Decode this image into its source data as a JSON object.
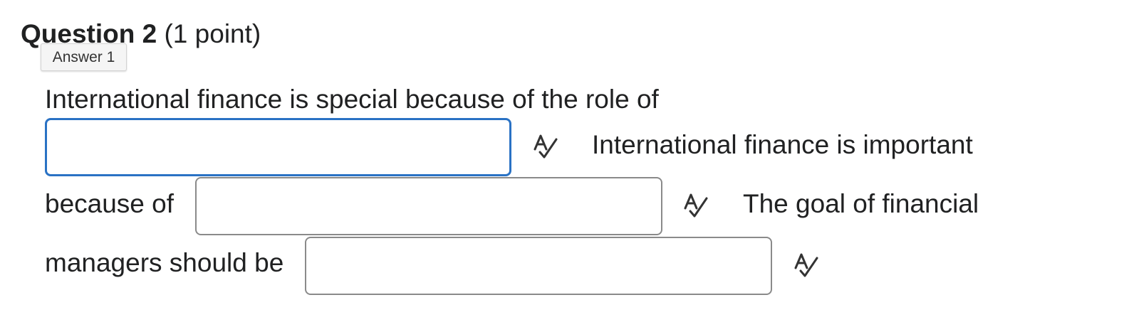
{
  "question": {
    "title": "Question 2",
    "points": "(1 point)"
  },
  "tooltip": {
    "text": "Answer 1"
  },
  "sentences": {
    "s1": "International finance is special because of the role of",
    "s2_part1": "International finance is important",
    "s2_part2": "because of",
    "s3_part1": "The goal of financial",
    "s3_part2": "managers should be"
  },
  "answers": [
    {
      "value": "",
      "placeholder": ""
    },
    {
      "value": "",
      "placeholder": ""
    },
    {
      "value": "",
      "placeholder": ""
    }
  ],
  "icons": {
    "spellcheck": "spell-check-icon"
  },
  "colors": {
    "focus_border": "#2a72c4",
    "input_border": "#8a8a8a",
    "text": "#202122"
  }
}
